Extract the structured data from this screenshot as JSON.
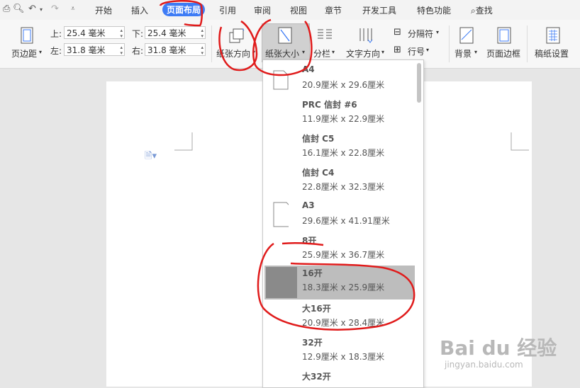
{
  "menubar": {
    "items": [
      "开始",
      "插入",
      "页面布局",
      "引用",
      "审阅",
      "视图",
      "章节",
      "开发工具",
      "特色功能"
    ],
    "active_index": 2,
    "search_label": "查找"
  },
  "toolbar": {
    "margin_button": "页边距",
    "margins": {
      "top_label": "上:",
      "top_value": "25.4 毫米",
      "bottom_label": "下:",
      "bottom_value": "25.4 毫米",
      "left_label": "左:",
      "left_value": "31.8 毫米",
      "right_label": "右:",
      "right_value": "31.8 毫米"
    },
    "orientation": "纸张方向",
    "paper_size": "纸张大小",
    "columns": "分栏",
    "text_direction": "文字方向",
    "separator": "分隔符",
    "line_number": "行号",
    "background": "背景",
    "page_border": "页面边框",
    "manuscript": "稿纸设置"
  },
  "paper_sizes": [
    {
      "name": "A4",
      "dims": "20.9厘米  x  29.6厘米"
    },
    {
      "name": "PRC 信封 #6",
      "dims": "11.9厘米  x  22.9厘米"
    },
    {
      "name": "信封 C5",
      "dims": "16.1厘米  x  22.8厘米"
    },
    {
      "name": "信封 C4",
      "dims": "22.8厘米  x  32.3厘米"
    },
    {
      "name": "A3",
      "dims": "29.6厘米  x  41.91厘米"
    },
    {
      "name": "8开",
      "dims": "25.9厘米  x  36.7厘米"
    },
    {
      "name": "16开",
      "dims": "18.3厘米  x  25.9厘米"
    },
    {
      "name": "大16开",
      "dims": "20.9厘米  x  28.4厘米"
    },
    {
      "name": "32开",
      "dims": "12.9厘米  x  18.3厘米"
    },
    {
      "name": "大32开",
      "dims": ""
    }
  ],
  "selected_paper_index": 6,
  "watermark": {
    "main": "Bai du 经验",
    "sub": "jingyan.baidu.com"
  },
  "colors": {
    "accent": "#3d7bf5",
    "annotation": "#e01b1b",
    "selected": "#bdbdbd"
  }
}
